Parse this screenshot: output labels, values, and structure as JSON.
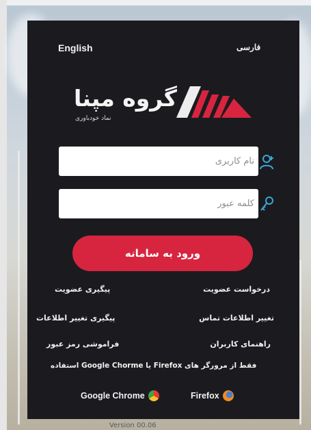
{
  "languages": {
    "english": "English",
    "farsi": "فارسی"
  },
  "logo": {
    "name": "گروه مپنا",
    "tagline": "نماد خودباوری"
  },
  "form": {
    "username_placeholder": "نام کاربری",
    "password_placeholder": "کلمه عبور",
    "login_label": "ورود به سامانه"
  },
  "links": {
    "membership_request": "درخواست عضویت",
    "membership_tracking": "پیگیری عضویت",
    "change_contact_info": "تغییر اطلاعات تماس",
    "track_info_change": "پیگیری تغییر اطلاعات",
    "user_guide": "راهنمای کاربران",
    "forgot_password": "فراموشی رمز عبور"
  },
  "browser_note": "فقط از مرورگر های Firefox یا Google Chorme استفاده",
  "browsers": {
    "chrome": "Google Chrome",
    "firefox": "Firefox"
  },
  "version_text": "Version 00.06",
  "colors": {
    "panel": "#1b1b1f",
    "accent": "#d7253f",
    "field": "#ffffff"
  },
  "icons": {
    "username": "user-plus-icon",
    "password": "key-icon",
    "chrome": "chrome-icon",
    "firefox": "firefox-icon"
  }
}
